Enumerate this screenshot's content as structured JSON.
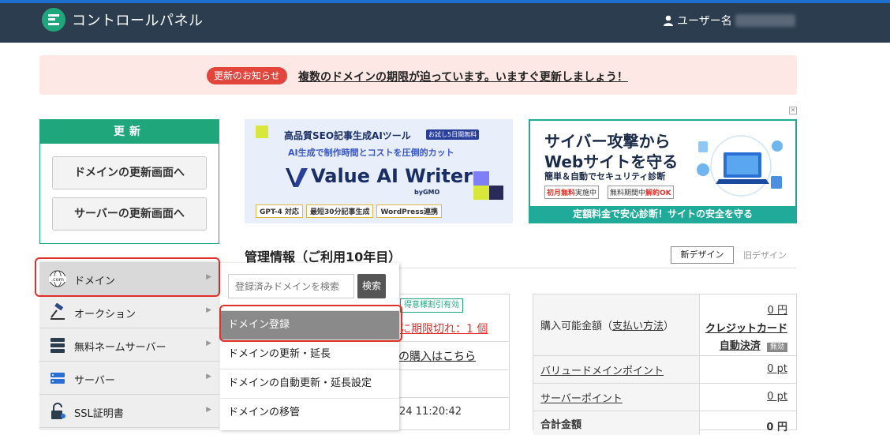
{
  "header": {
    "app_title": "コントロールパネル",
    "user_label": "ユーザー名"
  },
  "notice": {
    "badge": "更新のお知らせ",
    "message": "複数のドメインの期限が迫っています。いますぐ更新しましょう！"
  },
  "ad_close": "✕",
  "renew": {
    "title": "更新",
    "domain_button": "ドメインの更新画面へ",
    "server_button": "サーバーの更新画面へ"
  },
  "banner1": {
    "line1": "高品質SEO記事生成AIツール",
    "trial": "お試し5日間無料",
    "line2": "AI生成で制作時間とコストを圧倒的カット",
    "product": "Value AI Writer",
    "by": "byGMO",
    "features": [
      "GPT-4 対応",
      "最短30分記事生成",
      "WordPress連携"
    ]
  },
  "banner2": {
    "headline1": "サイバー攻撃から",
    "headline2": "Webサイトを守る",
    "sub": "簡単＆自動でセキュリティ診断",
    "tag1a": "初月無料",
    "tag1b": "実施中",
    "tag2a": "無料期間中",
    "tag2b": "解約OK",
    "footer": "定額料金で安心診断！サイトの安全を守る"
  },
  "management": {
    "title": "管理情報（ご利用10年目）",
    "new_design": "新デザイン",
    "old_design": "旧デザイン"
  },
  "left_table": {
    "badge": "得意様割引有効",
    "warning": "に期限切れ：1 個",
    "buy_link": "の購入はこちら",
    "date": "24 11:20:42"
  },
  "right_table": {
    "rows": [
      {
        "label": "購入可能金額（",
        "label_link": "支払い方法",
        "label_end": "）",
        "value": "0 円",
        "value2": "クレジットカード",
        "value3": "自動決済",
        "badge": "無効"
      },
      {
        "label_link": "バリュードメインポイント",
        "value": "0 pt"
      },
      {
        "label_link": "サーバーポイント",
        "value": "0 pt"
      },
      {
        "label": "合計金額",
        "value": "0 円"
      }
    ]
  },
  "sidebar": {
    "items": [
      {
        "label": "ドメイン",
        "arrow": "▶"
      },
      {
        "label": "オークション",
        "arrow": "▶"
      },
      {
        "label": "無料ネームサーバー",
        "arrow": "▶"
      },
      {
        "label": "サーバー",
        "arrow": "▶"
      },
      {
        "label": "SSL証明書",
        "arrow": "▶"
      }
    ],
    "domain_icon_text": ".com"
  },
  "flyout": {
    "search_placeholder": "登録済みドメインを検索",
    "search_button": "検索",
    "items": [
      "ドメイン登録",
      "ドメインの更新・延長",
      "ドメインの自動更新・延長設定",
      "ドメインの移管"
    ]
  }
}
